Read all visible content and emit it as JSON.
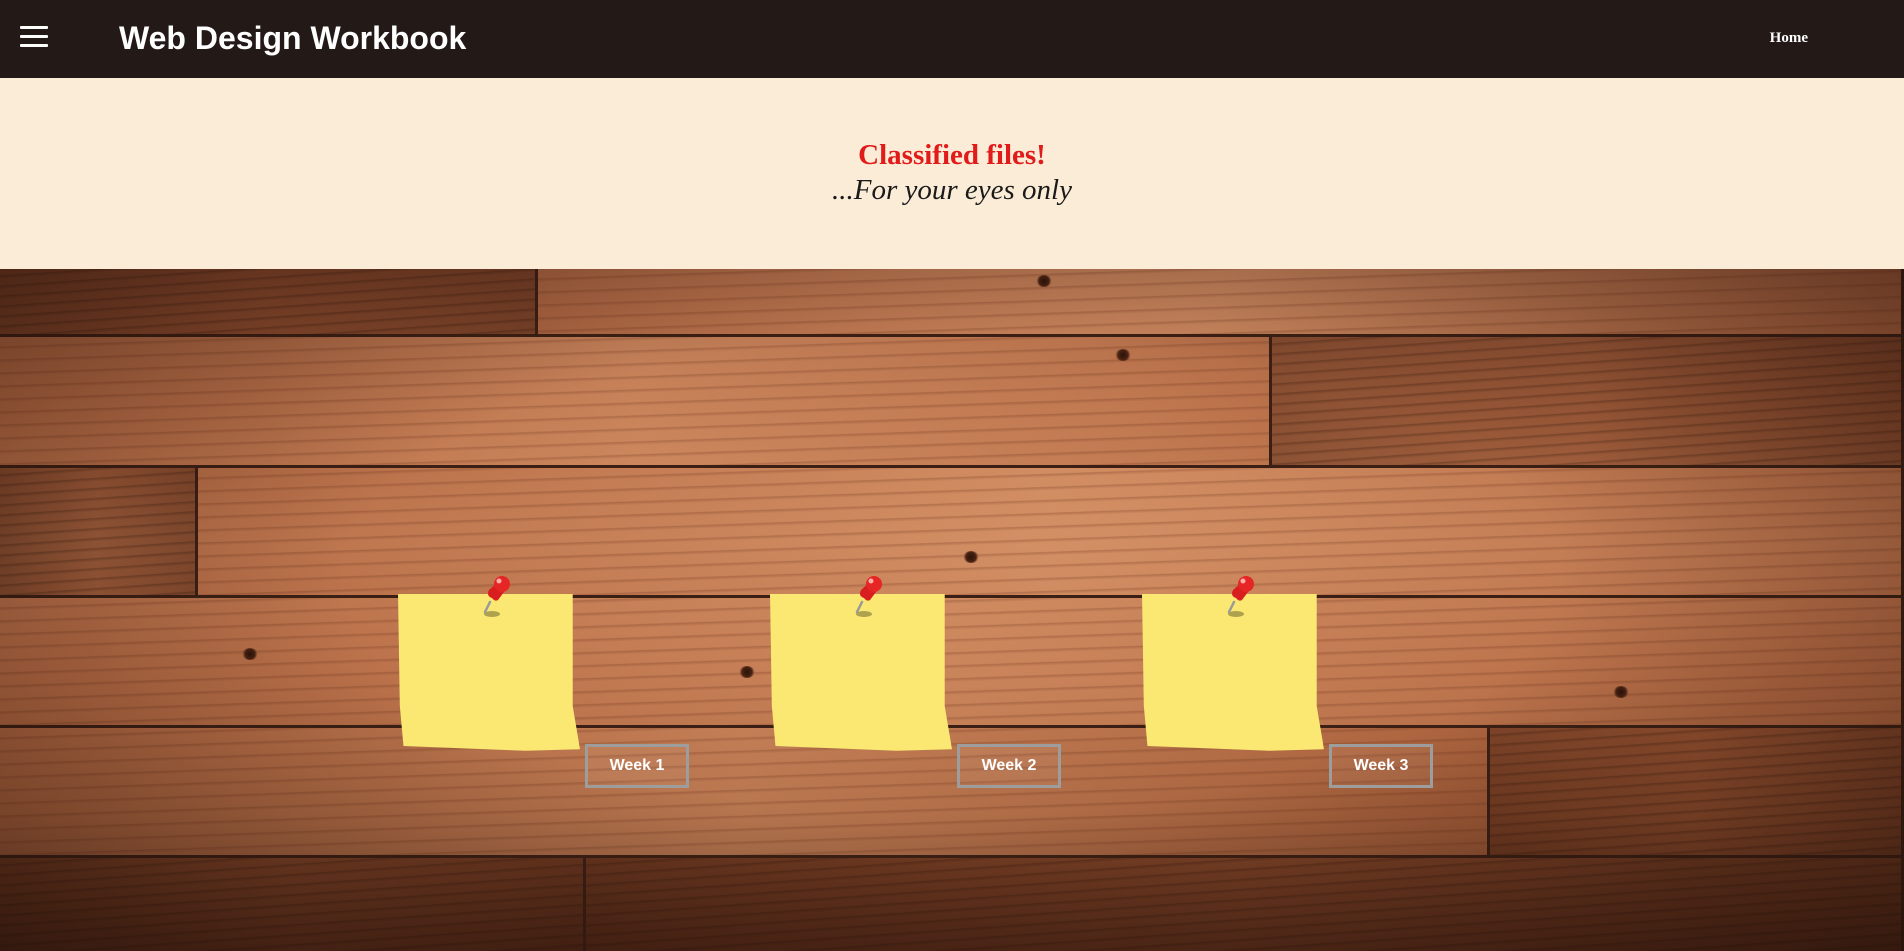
{
  "header": {
    "title": "Web Design Workbook",
    "menu_icon": "hamburger-menu-icon",
    "nav": [
      {
        "label": "Home"
      }
    ]
  },
  "hero": {
    "heading": "Classified files!",
    "subheading": "...For your eyes only",
    "heading_color": "#e11a1a"
  },
  "board": {
    "background": "wood-planks",
    "notes": [
      {
        "pin_icon": "pushpin-icon",
        "button_label": "Week 1"
      },
      {
        "pin_icon": "pushpin-icon",
        "button_label": "Week 2"
      },
      {
        "pin_icon": "pushpin-icon",
        "button_label": "Week 3"
      }
    ]
  },
  "colors": {
    "navbar_bg": "#231a18",
    "hero_bg": "#fbecd7",
    "note_yellow": "#fae872",
    "button_border": "#9d9d9d"
  }
}
